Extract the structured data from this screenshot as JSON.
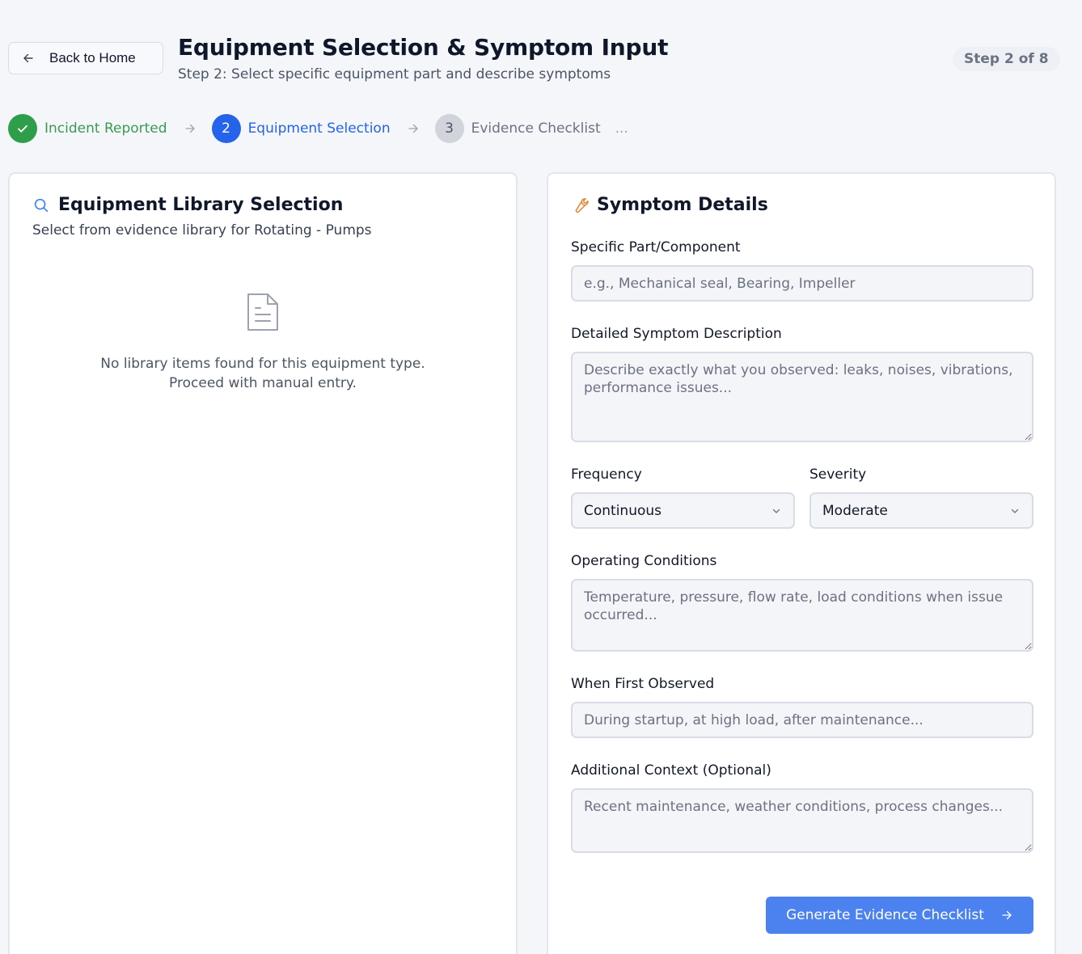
{
  "header": {
    "back_label": "Back to Home",
    "title": "Equipment Selection & Symptom Input",
    "subtitle": "Step 2: Select specific equipment part and describe symptoms",
    "step_badge": "Step 2 of 8"
  },
  "steps": [
    {
      "number": "✓",
      "label": "Incident Reported",
      "state": "done"
    },
    {
      "number": "2",
      "label": "Equipment Selection",
      "state": "active"
    },
    {
      "number": "3",
      "label": "Evidence Checklist",
      "state": "todo"
    }
  ],
  "steps_more": "...",
  "library": {
    "title": "Equipment Library Selection",
    "description": "Select from evidence library for Rotating - Pumps",
    "empty_line1": "No library items found for this equipment type.",
    "empty_line2": "Proceed with manual entry."
  },
  "symptoms": {
    "title": "Symptom Details",
    "part_label": "Specific Part/Component",
    "part_placeholder": "e.g., Mechanical seal, Bearing, Impeller",
    "description_label": "Detailed Symptom Description",
    "description_placeholder": "Describe exactly what you observed: leaks, noises, vibrations, performance issues...",
    "frequency_label": "Frequency",
    "frequency_value": "Continuous",
    "severity_label": "Severity",
    "severity_value": "Moderate",
    "conditions_label": "Operating Conditions",
    "conditions_placeholder": "Temperature, pressure, flow rate, load conditions when issue occurred...",
    "first_observed_label": "When First Observed",
    "first_observed_placeholder": "During startup, at high load, after maintenance...",
    "context_label": "Additional Context (Optional)",
    "context_placeholder": "Recent maintenance, weather conditions, process changes...",
    "submit_label": "Generate Evidence Checklist"
  },
  "colors": {
    "primary": "#2563eb",
    "success": "#2f9e4a",
    "button": "#4b82ef",
    "accent_icon": "#e08a3c"
  }
}
